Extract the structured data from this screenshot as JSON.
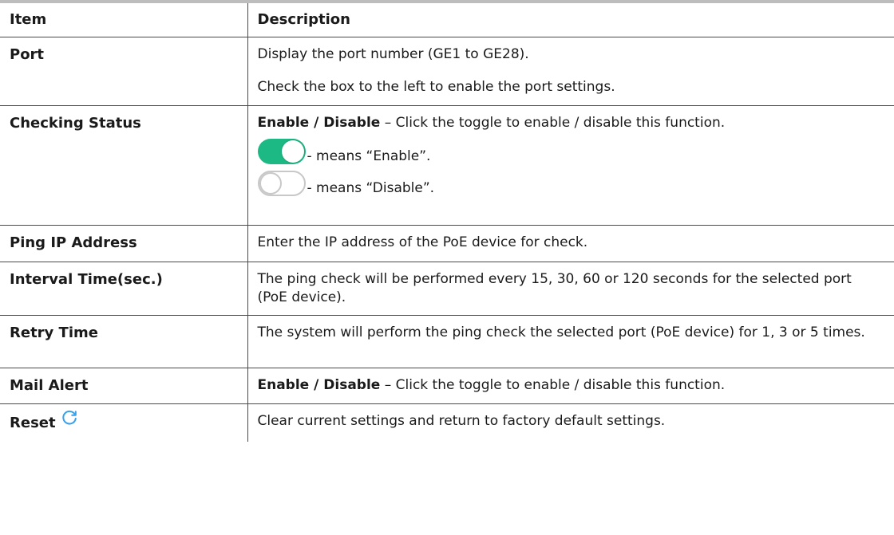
{
  "header": {
    "item": "Item",
    "description": "Description"
  },
  "rows": {
    "port": {
      "item": "Port",
      "desc1": "Display the port number (GE1 to GE28).",
      "desc2": "Check the box to the left to enable the port settings."
    },
    "checking_status": {
      "item": "Checking Status",
      "bold": "Enable / Disable",
      "text": " – Click the toggle to enable / disable this function.",
      "on_label": " - means “Enable”.",
      "off_label": " - means “Disable”.",
      "on_icon": "toggle-on-icon",
      "off_icon": "toggle-off-icon"
    },
    "ping_ip": {
      "item": "Ping IP Address",
      "desc": "Enter the IP address of the PoE device for check."
    },
    "interval": {
      "item": "Interval Time(sec.)",
      "desc": "The ping check will be performed every 15, 30, 60 or 120 seconds for the selected port (PoE device)."
    },
    "retry": {
      "item": "Retry Time",
      "desc": "The system will perform the ping check the selected port (PoE device) for 1, 3 or 5 times."
    },
    "mail_alert": {
      "item": "Mail Alert",
      "bold": "Enable / Disable",
      "text": " – Click the toggle to enable / disable this function."
    },
    "reset": {
      "item": "Reset",
      "icon": "refresh-icon",
      "desc": "Clear current settings and return to factory default settings."
    }
  },
  "colors": {
    "toggle_on": "#1db984",
    "refresh_icon": "#3aa0e8",
    "border": "#4a4a4a",
    "top_rule": "#bdbdbd"
  }
}
